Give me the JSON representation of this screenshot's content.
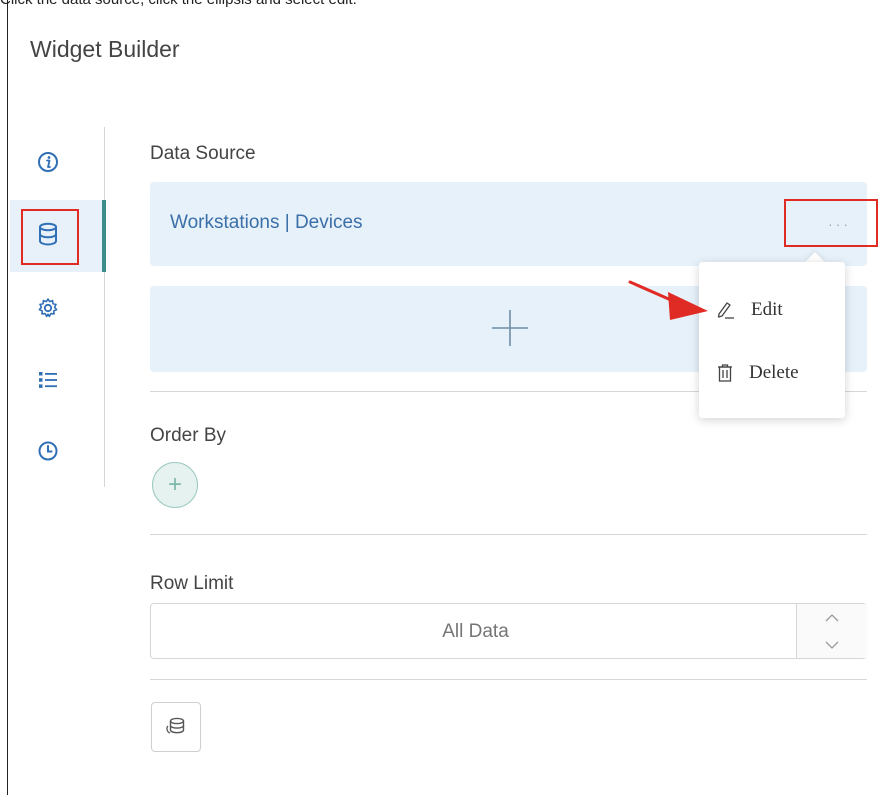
{
  "caption": "Click the data source, click the ellipsis and select edit.",
  "panel": {
    "title": "Widget Builder"
  },
  "sidebar": {
    "items": [
      {
        "name": "info-icon",
        "active": false
      },
      {
        "name": "database-icon",
        "active": true
      },
      {
        "name": "gear-icon",
        "active": false
      },
      {
        "name": "list-icon",
        "active": false
      },
      {
        "name": "clock-icon",
        "active": false
      }
    ]
  },
  "data_source": {
    "label": "Data Source",
    "name": "Workstations | Devices",
    "more": "···"
  },
  "add_source": {
    "icon": "plus-icon"
  },
  "order_by": {
    "label": "Order By",
    "add": "+"
  },
  "row_limit": {
    "label": "Row Limit",
    "placeholder": "All Data"
  },
  "menu": {
    "edit": "Edit",
    "delete": "Delete"
  },
  "colors": {
    "accent": "#3d8b8a",
    "highlight": "#e02b24",
    "card": "#e7f1fa",
    "link": "#3b6fa8"
  }
}
